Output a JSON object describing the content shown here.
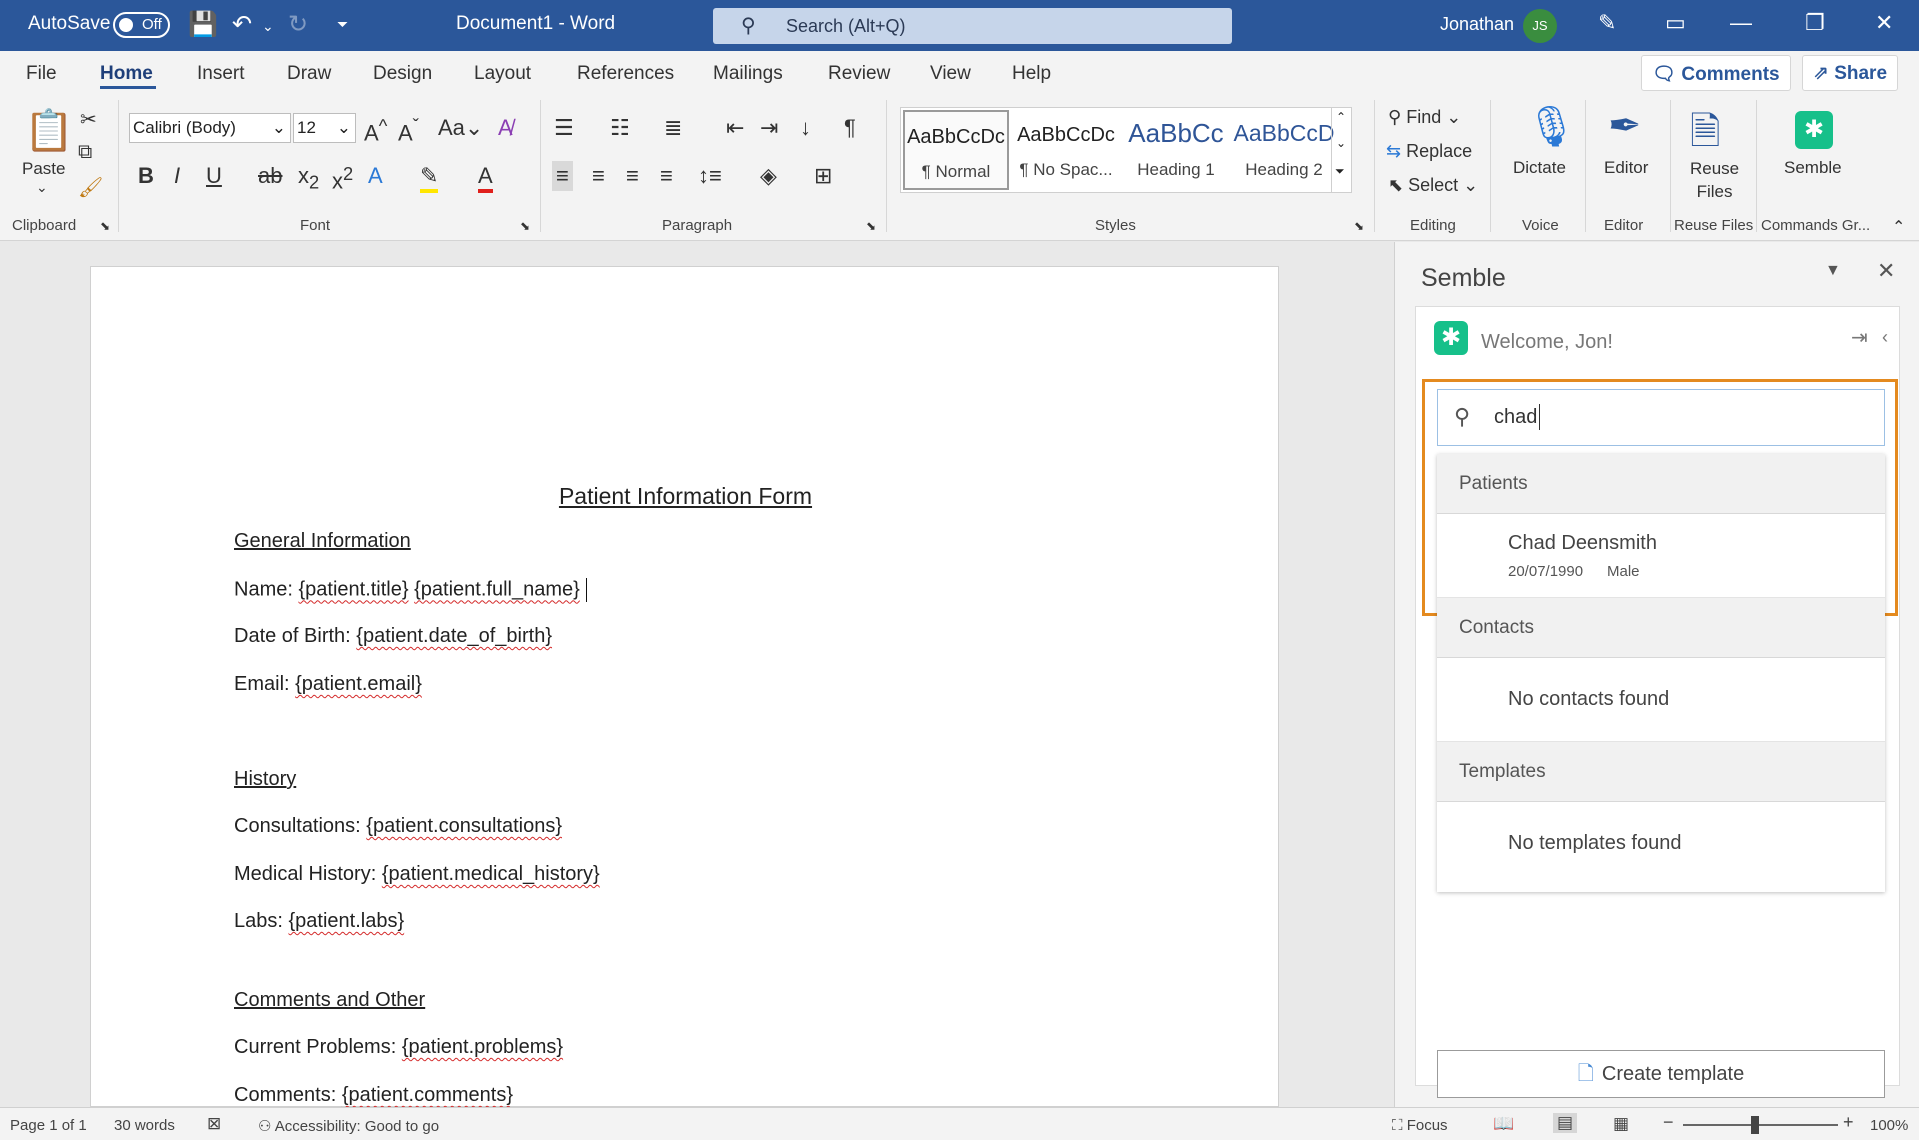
{
  "titlebar": {
    "autosave_label": "AutoSave",
    "autosave_state": "Off",
    "doc_title": "Document1  -  Word",
    "search_placeholder": "Search (Alt+Q)",
    "user_name": "Jonathan",
    "user_initials": "JS"
  },
  "ribbon": {
    "tabs": [
      "File",
      "Home",
      "Insert",
      "Draw",
      "Design",
      "Layout",
      "References",
      "Mailings",
      "Review",
      "View",
      "Help"
    ],
    "active_tab": "Home",
    "comments_label": "Comments",
    "share_label": "Share",
    "clipboard": {
      "paste": "Paste",
      "label": "Clipboard"
    },
    "font": {
      "name": "Calibri (Body)",
      "size": "12",
      "label": "Font"
    },
    "paragraph": {
      "label": "Paragraph"
    },
    "styles": {
      "label": "Styles",
      "items": [
        {
          "sample": "AaBbCcDc",
          "name": "¶ Normal"
        },
        {
          "sample": "AaBbCcDc",
          "name": "¶ No Spac..."
        },
        {
          "sample": "AaBbCc",
          "name": "Heading 1"
        },
        {
          "sample": "AaBbCcD",
          "name": "Heading 2"
        }
      ]
    },
    "editing": {
      "find": "Find",
      "replace": "Replace",
      "select": "Select",
      "label": "Editing"
    },
    "voice": {
      "dictate": "Dictate",
      "label": "Voice"
    },
    "editor": {
      "btn": "Editor",
      "label": "Editor"
    },
    "reuse": {
      "btn_line1": "Reuse",
      "btn_line2": "Files",
      "label": "Reuse Files"
    },
    "commands": {
      "btn": "Semble",
      "label": "Commands Gr..."
    }
  },
  "document": {
    "title": "Patient Information Form",
    "h_general": "General Information",
    "name_label": "Name: ",
    "name_v1": "{patient.title}",
    "name_v2": "{patient.full_name}",
    "dob_label": "Date of Birth: ",
    "dob_v": "{patient.date_of_birth}",
    "email_label": "Email: ",
    "email_v": "{patient.email}",
    "h_history": "History",
    "consult_label": "Consultations: ",
    "consult_v": "{patient.consultations}",
    "medhist_label": "Medical History: ",
    "medhist_v": "{patient.medical_history}",
    "labs_label": "Labs: ",
    "labs_v": "{patient.labs}",
    "h_comments": "Comments and Other",
    "problems_label": "Current Problems: ",
    "problems_v": "{patient.problems}",
    "comments_label": "Comments: ",
    "comments_v": "{patient.comments}"
  },
  "pane": {
    "title": "Semble",
    "welcome": "Welcome, Jon!",
    "search_value": "chad",
    "patients_header": "Patients",
    "patient": {
      "name": "Chad Deensmith",
      "dob": "20/07/1990",
      "gender": "Male"
    },
    "contacts_header": "Contacts",
    "contacts_empty": "No contacts found",
    "templates_header": "Templates",
    "templates_empty": "No templates found",
    "create_template": "Create template"
  },
  "status": {
    "page": "Page 1 of 1",
    "words": "30 words",
    "accessibility": "Accessibility: Good to go",
    "focus": "Focus",
    "zoom": "100%"
  },
  "colors": {
    "titlebar": "#2b579a",
    "accent": "#2b579a",
    "highlight_border": "#e48a1f",
    "semble_green": "#16c08a"
  }
}
